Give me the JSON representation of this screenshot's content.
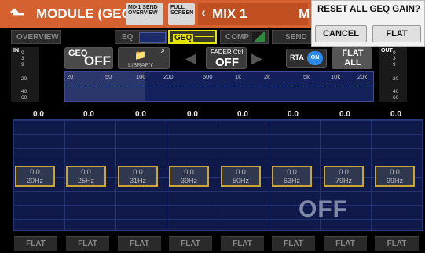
{
  "window": {
    "title": "MODULE (GEQ)",
    "mix_label": "MIX 1",
    "module_letter": "M"
  },
  "small_buttons": {
    "mix_send_overview": "MIX1 SEND OVERVIEW",
    "full_screen": "FULL SCREEN"
  },
  "tabs": [
    {
      "label": "OVERVIEW"
    },
    {
      "label": "EQ"
    },
    {
      "label": "GEQ"
    },
    {
      "label": "COMP"
    },
    {
      "label": "SEND"
    }
  ],
  "dialog": {
    "title": "RESET ALL GEQ GAIN?",
    "cancel_label": "CANCEL",
    "flat_label": "FLAT"
  },
  "controls": {
    "geq_label": "GEQ",
    "geq_state": "OFF",
    "library_label": "LIBRARY",
    "fader_ctrl_label": "FADER Ctrl",
    "fader_ctrl_state": "OFF",
    "rta_label": "RTA",
    "rta_state": "ON",
    "flat_all_label": "FLAT ALL"
  },
  "meters": {
    "in_label": "IN",
    "out_label": "OUT",
    "scale": [
      "0",
      "3",
      "9",
      "20",
      "40",
      "60"
    ]
  },
  "frequency_axis": [
    "20",
    "50",
    "100",
    "200",
    "500",
    "1k",
    "2k",
    "5k",
    "10k",
    "20k"
  ],
  "band_values": [
    "0.0",
    "0.0",
    "0.0",
    "0.0",
    "0.0",
    "0.0",
    "0.0",
    "0.0"
  ],
  "bands": [
    {
      "gain": "0.0",
      "freq": "20Hz"
    },
    {
      "gain": "0.0",
      "freq": "25Hz"
    },
    {
      "gain": "0.0",
      "freq": "31Hz"
    },
    {
      "gain": "0.0",
      "freq": "39Hz"
    },
    {
      "gain": "0.0",
      "freq": "50Hz"
    },
    {
      "gain": "0.0",
      "freq": "63Hz"
    },
    {
      "gain": "0.0",
      "freq": "79Hz"
    },
    {
      "gain": "0.0",
      "freq": "99Hz"
    }
  ],
  "graph_overlay": "OFF",
  "flat_buttons": [
    "FLAT",
    "FLAT",
    "FLAT",
    "FLAT",
    "FLAT",
    "FLAT",
    "FLAT",
    "FLAT"
  ],
  "colors": {
    "title_bar": "#d4612f",
    "geq_tab_accent": "#e6e600",
    "band_border": "#caa531",
    "rta_on": "#2b8ae8"
  }
}
